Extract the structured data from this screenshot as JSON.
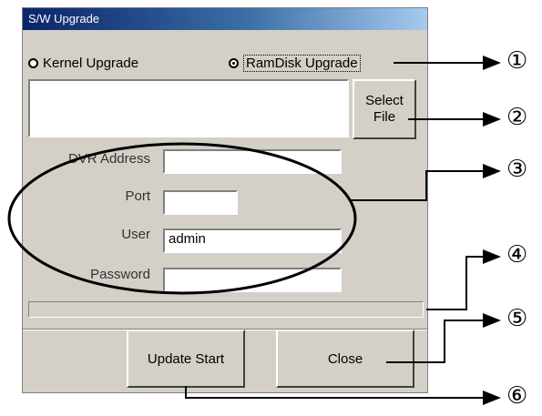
{
  "window": {
    "title": "S/W Upgrade"
  },
  "upgrade_type": {
    "kernel_label": "Kernel Upgrade",
    "ramdisk_label": "RamDisk Upgrade",
    "selected": "RamDisk Upgrade"
  },
  "file": {
    "path_value": "",
    "select_label": "Select\nFile"
  },
  "network": {
    "dvr_address_label": "DVR Address",
    "dvr_address_value": "",
    "port_label": "Port",
    "port_value": "",
    "user_label": "User",
    "user_value": "admin",
    "password_label": "Password",
    "password_value": ""
  },
  "progress": {
    "value": 0
  },
  "buttons": {
    "update_start": "Update Start",
    "close": "Close"
  },
  "callouts": [
    "①",
    "②",
    "③",
    "④",
    "⑤",
    "⑥"
  ]
}
